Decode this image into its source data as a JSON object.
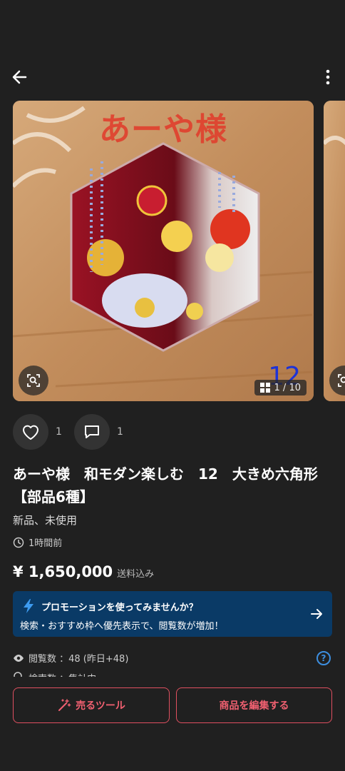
{
  "header": {
    "back_icon": "arrow-left-icon",
    "more_icon": "more-vertical-icon"
  },
  "gallery": {
    "caption": "あーや様",
    "photo_number": "12",
    "counter": "1 / 10",
    "current_index": 1,
    "total": 10
  },
  "actions": {
    "like_count": "1",
    "comment_count": "1"
  },
  "product": {
    "title": "あーや様　和モダン楽しむ　12　大きめ六角形【部品6種】",
    "condition": "新品、未使用",
    "posted": "1時間前",
    "price": "¥ 1,650,000",
    "shipping": "送料込み"
  },
  "promo": {
    "title": "プロモーションを使ってみませんか？",
    "description": "検索・おすすめ枠へ優先表示で、閲覧数が増加！"
  },
  "stats": {
    "views": "閲覧数 ：48 (昨日+48)",
    "search": "検索数 ：集計中"
  },
  "buttons": {
    "sell_tools": "売るツール",
    "edit": "商品を編集する"
  },
  "colors": {
    "background": "#202020",
    "promo_bg": "#0a3a66",
    "button_accent": "#e05060",
    "caption": "#e23a2a",
    "help": "#3d8fe0"
  }
}
